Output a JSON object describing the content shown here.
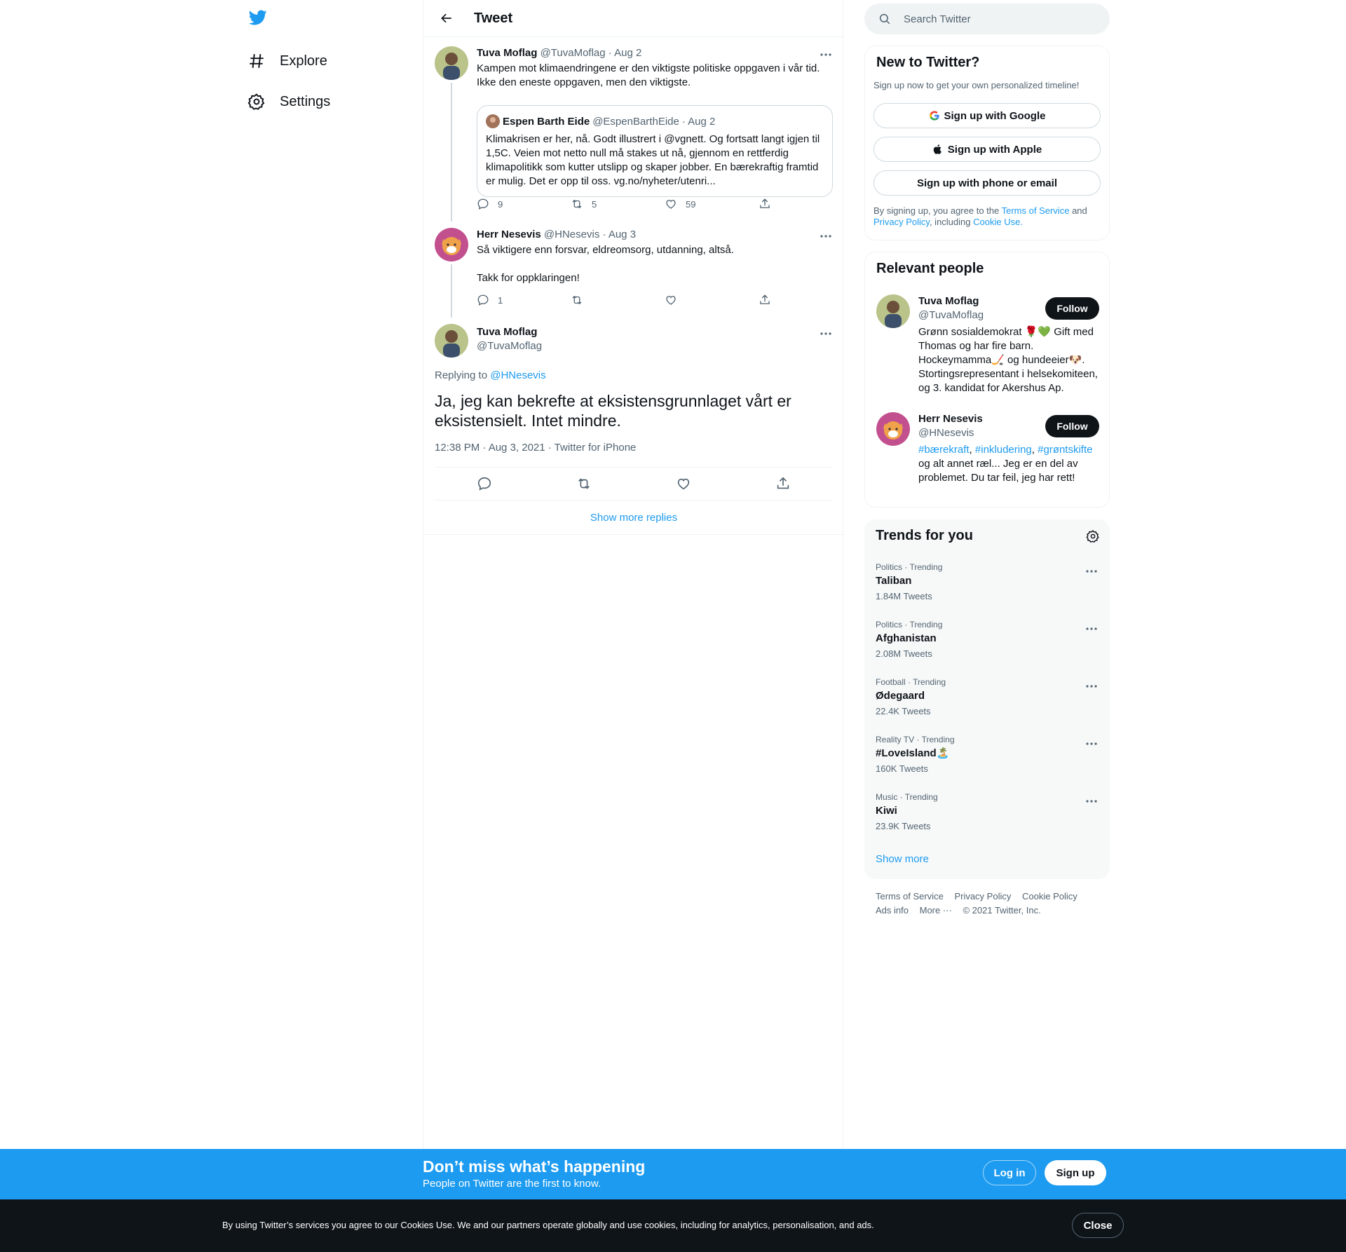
{
  "nav": {
    "logo": "twitter-bird-icon",
    "items": [
      {
        "label": "Explore",
        "icon": "hashtag-icon"
      },
      {
        "label": "Settings",
        "icon": "gear-icon"
      }
    ]
  },
  "header": {
    "title": "Tweet",
    "back_icon": "back-arrow-icon"
  },
  "thread": [
    {
      "name": "Tuva Moflag",
      "handle": "@TuvaMoflag",
      "date": "· Aug 2",
      "text_lines": [
        "Kampen mot klimaendringene er den viktigste politiske oppgaven i vår tid.",
        "Ikke den eneste oppgaven, men den viktigste."
      ],
      "quote": {
        "name": "Espen Barth Eide",
        "handle": "@EspenBarthEide",
        "date": "· Aug 2",
        "text": "Klimakrisen er her, nå. Godt illustrert i @vgnett. Og fortsatt langt igjen til 1,5C. Veien mot netto null må stakes ut nå, gjennom en rettferdig klimapolitikk som kutter utslipp og skaper jobber. En bærekraftig framtid er mulig. Det er opp til oss. vg.no/nyheter/utenri..."
      },
      "replies": "9",
      "retweets": "5",
      "likes": "59"
    },
    {
      "name": "Herr Nesevis",
      "handle": "@HNesevis",
      "date": "· Aug 3",
      "text_lines": [
        "Så viktigere enn forsvar, eldreomsorg, utdanning, altså.",
        "",
        "Takk for oppklaringen!"
      ],
      "replies": "1",
      "retweets": "",
      "likes": ""
    }
  ],
  "focus": {
    "name": "Tuva Moflag",
    "handle": "@TuvaMoflag",
    "replying_label": "Replying to",
    "replying_to": "@HNesevis",
    "text": "Ja, jeg kan bekrefte at eksistensgrunnlaget vårt er eksistensielt. Intet mindre.",
    "timestamp": "12:38 PM · Aug 3, 2021 · Twitter for iPhone"
  },
  "show_more_replies": "Show more replies",
  "search": {
    "placeholder": "Search Twitter"
  },
  "new_to_twitter": {
    "title": "New to Twitter?",
    "subtitle": "Sign up now to get your own personalized timeline!",
    "google": "Sign up with Google",
    "apple": "Sign up with Apple",
    "phone": "Sign up with phone or email",
    "legal_1": "By signing up, you agree to the",
    "tos": "Terms of Service",
    "and": "and",
    "privacy": "Privacy Policy",
    "including": ", including",
    "cookie": "Cookie Use."
  },
  "relevant_people": {
    "title": "Relevant people",
    "people": [
      {
        "name": "Tuva Moflag",
        "handle": "@TuvaMoflag",
        "follow": "Follow",
        "bio": "Grønn sosialdemokrat 🌹💚 Gift med Thomas og har fire barn. Hockeymamma🏒 og hundeeier🐶. Stortingsrepresentant i helsekomiteen, og 3. kandidat for Akershus Ap."
      },
      {
        "name": "Herr Nesevis",
        "handle": "@HNesevis",
        "follow": "Follow",
        "bio_tags": [
          "#bærekraft",
          "#inkludering",
          "#grøntskifte"
        ],
        "bio_rest": "og alt annet ræl... Jeg er en del av problemet. Du tar feil, jeg har rett!"
      }
    ]
  },
  "trends": {
    "title": "Trends for you",
    "items": [
      {
        "category": "Politics · Trending",
        "name": "Taliban",
        "count": "1.84M Tweets"
      },
      {
        "category": "Politics · Trending",
        "name": "Afghanistan",
        "count": "2.08M Tweets"
      },
      {
        "category": "Football · Trending",
        "name": "Ødegaard",
        "count": "22.4K Tweets"
      },
      {
        "category": "Reality TV · Trending",
        "name": "#LoveIsland🏝️",
        "count": "160K Tweets"
      },
      {
        "category": "Music · Trending",
        "name": "Kiwi",
        "count": "23.9K Tweets"
      }
    ],
    "show_more": "Show more"
  },
  "footer": {
    "links": [
      "Terms of Service",
      "Privacy Policy",
      "Cookie Policy",
      "Ads info",
      "More ···"
    ],
    "copyright": "© 2021 Twitter, Inc."
  },
  "signup_bar": {
    "title": "Don’t miss what’s happening",
    "subtitle": "People on Twitter are the first to know.",
    "login": "Log in",
    "signup": "Sign up"
  },
  "cookie_bar": {
    "text": "By using Twitter’s services you agree to our Cookies Use. We and our partners operate globally and use cookies, including for analytics, personalisation, and ads.",
    "close": "Close"
  },
  "colors": {
    "accent": "#1d9bf0",
    "text": "#0f1419",
    "secondary": "#536471",
    "border": "#eff3f4"
  }
}
